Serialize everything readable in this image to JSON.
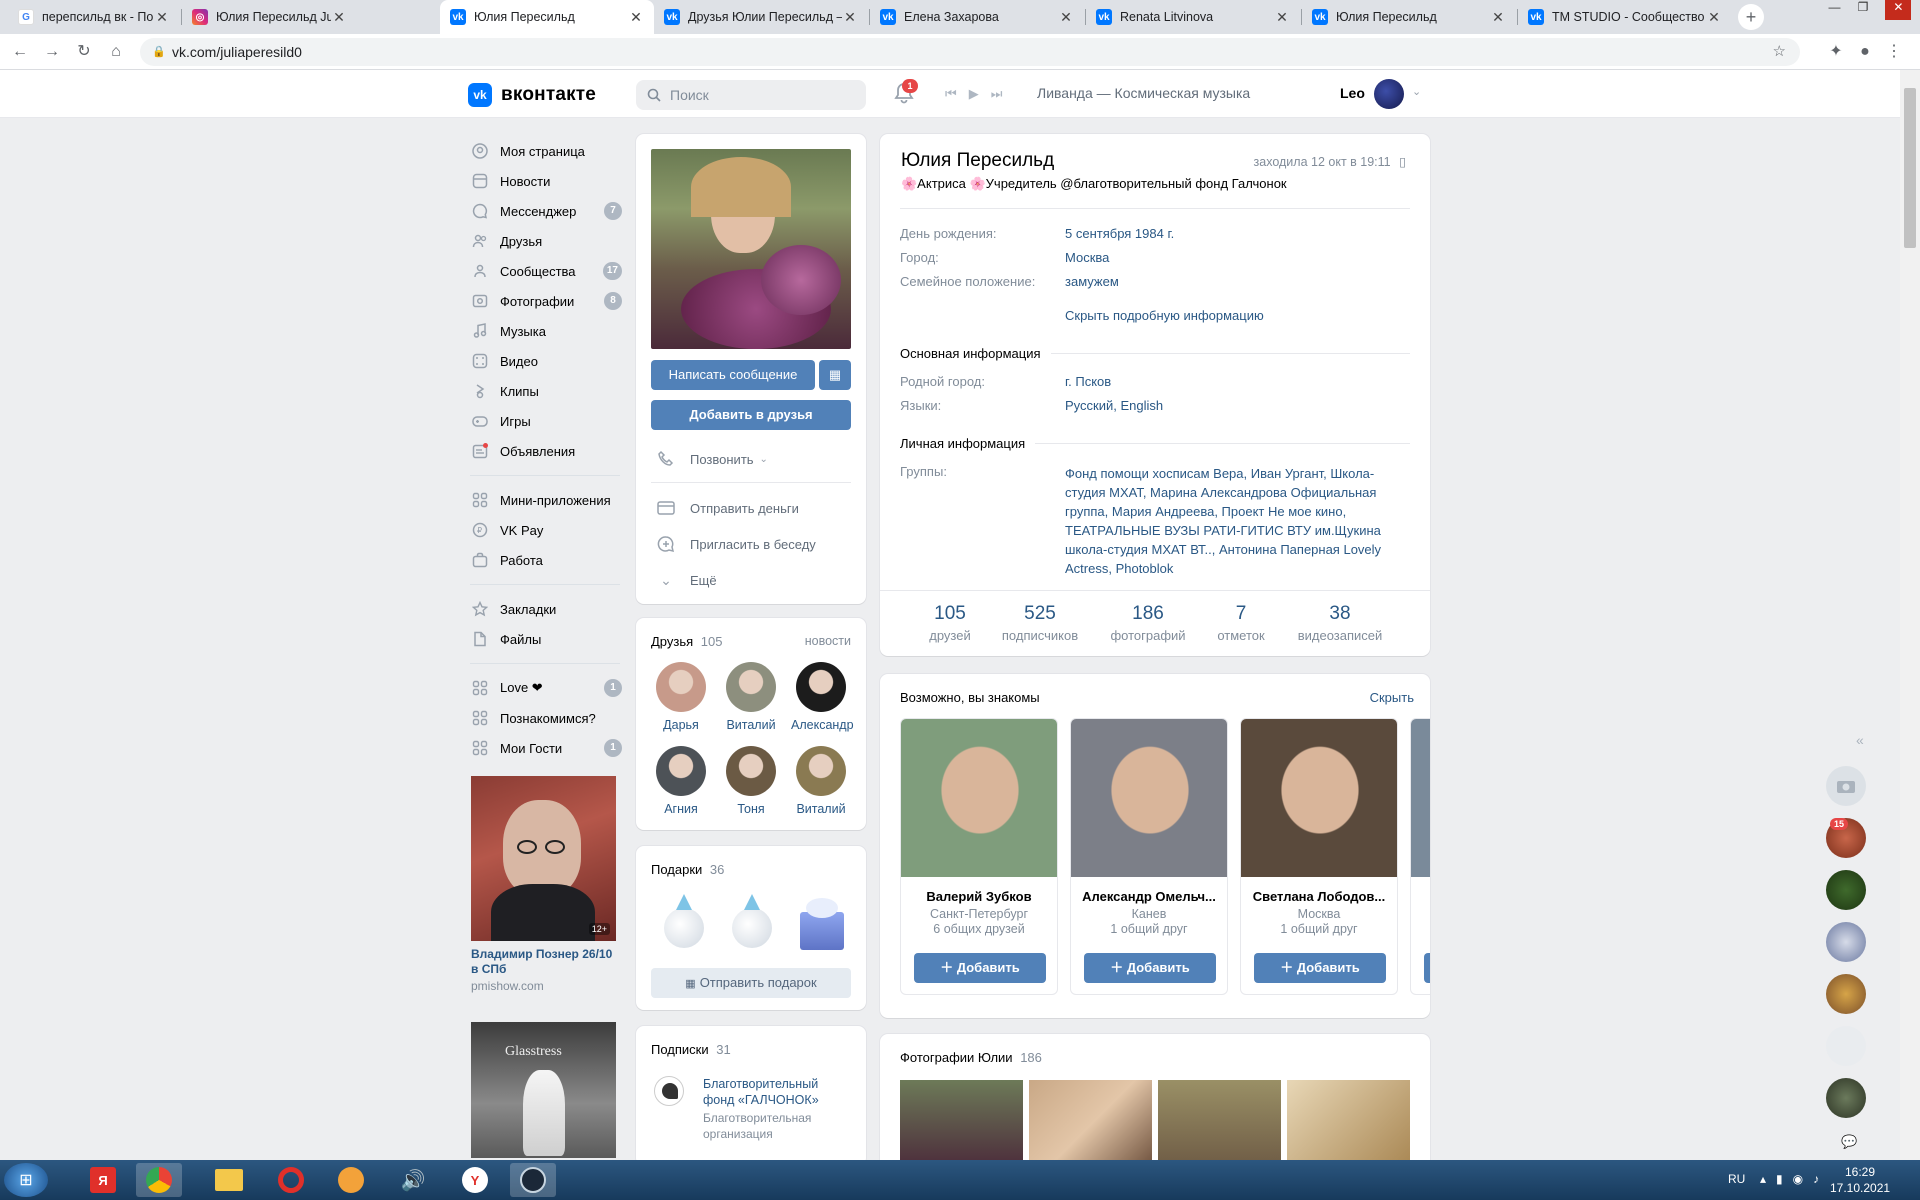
{
  "browser": {
    "tabs": [
      {
        "title": "перепсильд вк - Поиск в Google",
        "icon": "google-icon",
        "color": "#4285f4"
      },
      {
        "title": "Юлия Пересильд Julia Peresild",
        "icon": "instagram-icon",
        "color": "#c13584"
      },
      {
        "title": "Юлия Пересильд",
        "icon": "vk-icon",
        "color": "#0077ff"
      },
      {
        "title": "Друзья Юлии Пересильд –",
        "icon": "vk-icon",
        "color": "#0077ff"
      },
      {
        "title": "Елена Захарова",
        "icon": "vk-icon",
        "color": "#0077ff"
      },
      {
        "title": "Renata Litvinova",
        "icon": "vk-icon",
        "color": "#0077ff"
      },
      {
        "title": "Юлия Пересильд",
        "icon": "vk-icon",
        "color": "#0077ff"
      },
      {
        "title": "TM STUDIO - Сообщество",
        "icon": "vk-icon",
        "color": "#0077ff"
      }
    ],
    "url": "vk.com/juliaperesild0"
  },
  "header": {
    "logo_text": "вконтакте",
    "logo_mark": "vk",
    "search_placeholder": "Поиск",
    "notifications_count": "1",
    "now_playing": "Ливанда — Космическая музыка",
    "user_name": "Leo"
  },
  "menu": {
    "main": [
      {
        "label": "Моя страница",
        "icon": "user-circle-icon",
        "count": ""
      },
      {
        "label": "Новости",
        "icon": "news-icon",
        "count": ""
      },
      {
        "label": "Мессенджер",
        "icon": "message-icon",
        "count": "7"
      },
      {
        "label": "Друзья",
        "icon": "friends-icon",
        "count": ""
      },
      {
        "label": "Сообщества",
        "icon": "communities-icon",
        "count": "17"
      },
      {
        "label": "Фотографии",
        "icon": "photo-icon",
        "count": "8"
      },
      {
        "label": "Музыка",
        "icon": "music-icon",
        "count": ""
      },
      {
        "label": "Видео",
        "icon": "video-icon",
        "count": ""
      },
      {
        "label": "Клипы",
        "icon": "clips-icon",
        "count": ""
      },
      {
        "label": "Игры",
        "icon": "gamepad-icon",
        "count": ""
      },
      {
        "label": "Объявления",
        "icon": "ads-icon",
        "count": ""
      }
    ],
    "services": [
      {
        "label": "Мини-приложения",
        "icon": "apps-icon",
        "count": ""
      },
      {
        "label": "VK Pay",
        "icon": "vkpay-icon",
        "count": ""
      },
      {
        "label": "Работа",
        "icon": "briefcase-icon",
        "count": ""
      }
    ],
    "extra": [
      {
        "label": "Закладки",
        "icon": "star-icon",
        "count": ""
      },
      {
        "label": "Файлы",
        "icon": "file-icon",
        "count": ""
      }
    ],
    "apps": [
      {
        "label": "Love ❤",
        "icon": "apps-icon",
        "count": "1"
      },
      {
        "label": "Познакомимся?",
        "icon": "apps-icon",
        "count": ""
      },
      {
        "label": "Мои Гости",
        "icon": "apps-icon",
        "count": "1"
      }
    ]
  },
  "ads": [
    {
      "title": "Владимир Познер 26/10 в СПб",
      "domain": "pmishow.com",
      "age": "12+"
    },
    {
      "title": "",
      "domain": "",
      "poster_text": "Glasstress"
    }
  ],
  "profile": {
    "name": "Юлия Пересильд",
    "last_seen": "заходила 12 окт в 19:11",
    "status": "🌸Актриса 🌸Учредитель @благотворительный фонд Галчонок",
    "info": [
      {
        "label": "День рождения:",
        "value": "5 сентября 1984 г."
      },
      {
        "label": "Город:",
        "value": "Москва"
      },
      {
        "label": "Семейное положение:",
        "value": "замужем"
      }
    ],
    "hide_details": "Скрыть подробную информацию",
    "main_info_title": "Основная информация",
    "main_info": [
      {
        "label": "Родной город:",
        "value": "г. Псков"
      },
      {
        "label": "Языки:",
        "value": "Русский, English"
      }
    ],
    "personal_title": "Личная информация",
    "groups_label": "Группы:",
    "groups_value": "Фонд помощи хосписам Вера, Иван Ургант, Школа-студия МХАТ, Марина Александрова Официальная группа, Мария Андреева, Проект Не мое кино, ТЕАТРАЛЬНЫЕ ВУЗЫ РАТИ-ГИТИС ВТУ им.Щукина школа-студия МХАТ ВТ.., Антонина Паперная Lovely Actress, Photoblok",
    "stats": [
      {
        "n": "105",
        "l": "друзей"
      },
      {
        "n": "525",
        "l": "подписчиков"
      },
      {
        "n": "186",
        "l": "фотографий"
      },
      {
        "n": "7",
        "l": "отметок"
      },
      {
        "n": "38",
        "l": "видеозаписей"
      }
    ]
  },
  "actions": {
    "write": "Написать сообщение",
    "add_friend": "Добавить в друзья",
    "call": "Позвонить",
    "send_money": "Отправить деньги",
    "invite": "Пригласить в беседу",
    "more": "Ещё"
  },
  "friends": {
    "title": "Друзья",
    "count": "105",
    "news_link": "новости",
    "items": [
      {
        "name": "Дарья",
        "color": "#c79a8a"
      },
      {
        "name": "Виталий",
        "color": "#8d8f7e"
      },
      {
        "name": "Александр",
        "color": "#1c1c1c"
      },
      {
        "name": "Агния",
        "color": "#4d5257"
      },
      {
        "name": "Тоня",
        "color": "#6b5a44"
      },
      {
        "name": "Виталий",
        "color": "#8a7a52"
      }
    ]
  },
  "gifts": {
    "title": "Подарки",
    "count": "36",
    "send": "Отправить подарок"
  },
  "subscriptions": {
    "title": "Подписки",
    "count": "31",
    "item_name": "Благотворительный фонд «ГАЛЧОНОК»",
    "item_desc": "Благотворительная организация"
  },
  "suggest": {
    "title": "Возможно, вы знакомы",
    "hide": "Скрыть",
    "add_label": "Добавить",
    "people": [
      {
        "name": "Валерий Зубков",
        "city": "Санкт-Петербург",
        "mutual": "6 общих друзей",
        "color": "#7f9d7c"
      },
      {
        "name": "Александр Омельч...",
        "city": "Канев",
        "mutual": "1 общий друг",
        "color": "#7c7f88"
      },
      {
        "name": "Светлана Лободов...",
        "city": "Москва",
        "mutual": "1 общий друг",
        "color": "#5a4a3c"
      }
    ]
  },
  "photos": {
    "title": "Фотографии Юлии",
    "count": "186"
  },
  "chat_sidebar": {
    "badge": "15"
  },
  "taskbar": {
    "lang": "RU",
    "time": "16:29",
    "date": "17.10.2021"
  }
}
